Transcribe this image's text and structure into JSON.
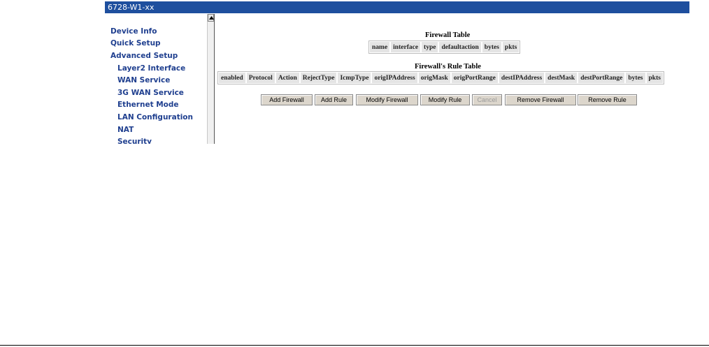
{
  "window": {
    "title": "6728-W1-xx"
  },
  "sidebar": {
    "items": [
      {
        "label": "Device Info",
        "level": "top"
      },
      {
        "label": "Quick Setup",
        "level": "top"
      },
      {
        "label": "Advanced Setup",
        "level": "top"
      },
      {
        "label": "Layer2 Interface",
        "level": "sub"
      },
      {
        "label": "WAN Service",
        "level": "sub"
      },
      {
        "label": "3G WAN Service",
        "level": "sub"
      },
      {
        "label": "Ethernet Mode",
        "level": "sub"
      },
      {
        "label": "LAN Configuration",
        "level": "sub"
      },
      {
        "label": "NAT",
        "level": "sub"
      },
      {
        "label": "Security",
        "level": "sub"
      }
    ]
  },
  "firewall_table": {
    "title": "Firewall Table",
    "columns": [
      "name",
      "interface",
      "type",
      "defaultaction",
      "bytes",
      "pkts"
    ]
  },
  "rule_table": {
    "title": "Firewall's Rule Table",
    "columns": [
      "enabled",
      "Protocol",
      "Action",
      "RejectType",
      "IcmpType",
      "origIPAddress",
      "origMask",
      "origPortRange",
      "destIPAddress",
      "destMask",
      "destPortRange",
      "bytes",
      "pkts"
    ]
  },
  "buttons": {
    "add_firewall": "Add Firewall",
    "add_rule": "Add Rule",
    "modify_firewall": "Modify Firewall",
    "modify_rule": "Modify Rule",
    "cancel": "Cancel",
    "remove_firewall": "Remove Firewall",
    "remove_rule": "Remove Rule"
  },
  "colors": {
    "title_bar": "#1e4f9e",
    "nav_link": "#1f3f8f",
    "header_cell": "#e4e4e4",
    "button_face": "#dcd6cc"
  }
}
